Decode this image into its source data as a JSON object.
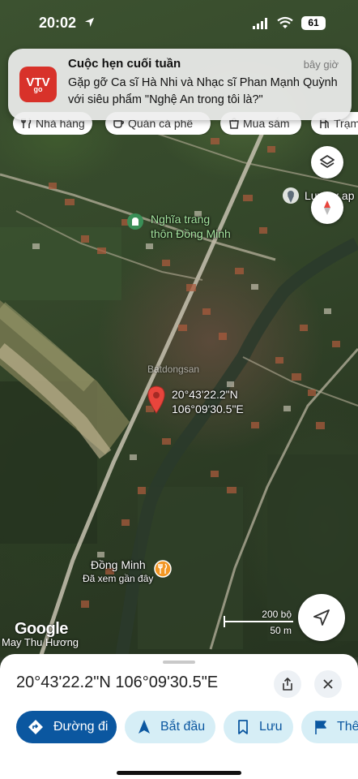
{
  "status_bar": {
    "time": "20:02",
    "battery": "61"
  },
  "notification": {
    "app_icon_text": "VTV",
    "app_icon_sub": "go",
    "title": "Cuộc hẹn cuối tuần",
    "time": "bây giờ",
    "body": "Gặp gỡ Ca sĩ Hà Nhi và Nhạc sĩ Phan Mạnh Quỳnh với siêu phẩm \"Nghệ An trong tôi là?\""
  },
  "chips": [
    {
      "label": "Nhà hàng",
      "icon": "restaurant-icon"
    },
    {
      "label": "Quán cà phê",
      "icon": "coffee-icon"
    },
    {
      "label": "Mua sắm",
      "icon": "shopping-icon"
    },
    {
      "label": "Trạm",
      "icon": "gas-station-icon"
    }
  ],
  "map": {
    "labels": {
      "cemetery_line1": "Nghĩa trang",
      "cemetery_line2": "thôn Đồng Minh",
      "luxury": "Luxury ap",
      "pin_lat": "20°43'22.2\"N",
      "pin_lon": "106°09'30.5\"E",
      "dong_minh": "Đồng Minh",
      "dong_minh_sub": "Đã xem gần đây",
      "watermark": "Batdongsan"
    },
    "attribution": "Google",
    "attribution_sub": "May Thu Hương",
    "scale_imperial": "200 bộ",
    "scale_metric": "50 m",
    "colors": {
      "pin": "#e8453c",
      "poi_food": "#f29624",
      "poi_cemetery": "#3a8f57"
    }
  },
  "sheet": {
    "coordinates": "20°43'22.2\"N 106°09'30.5\"E",
    "actions": [
      {
        "label": "Đường đi",
        "icon": "directions-icon"
      },
      {
        "label": "Bắt đầu",
        "icon": "navigation-start-icon"
      },
      {
        "label": "Lưu",
        "icon": "bookmark-icon"
      },
      {
        "label": "Thê",
        "icon": "flag-icon"
      }
    ],
    "accent": "#0b57a0"
  }
}
